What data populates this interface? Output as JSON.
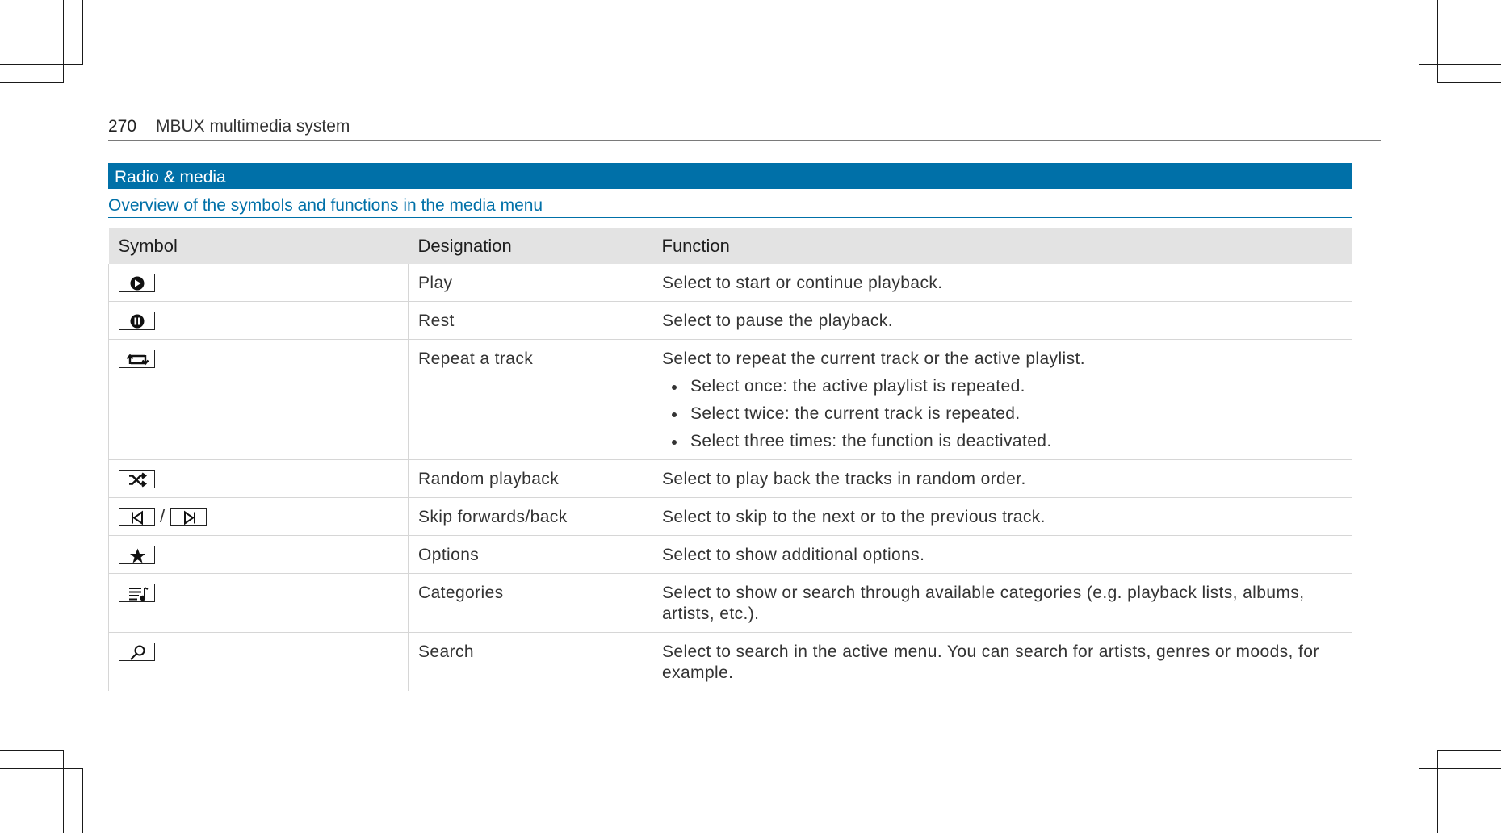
{
  "header": {
    "page_number": "270",
    "title": "MBUX multimedia system"
  },
  "section": {
    "title": "Radio & media"
  },
  "subsection": {
    "title": "Overview of the symbols and functions in the media menu"
  },
  "table": {
    "headers": {
      "symbol": "Symbol",
      "designation": "Designation",
      "function": "Function"
    },
    "rows": [
      {
        "icon": "play-icon",
        "designation": "Play",
        "function": "Select to start or continue playback."
      },
      {
        "icon": "pause-icon",
        "designation": "Rest",
        "function": "Select to pause the playback."
      },
      {
        "icon": "repeat-icon",
        "designation": "Repeat a track",
        "function": "Select to repeat the current track or the active playlist.",
        "bullets": [
          "Select once: the active playlist is repeated.",
          "Select twice: the current track is repeated.",
          "Select three times: the function is deactivated."
        ]
      },
      {
        "icon": "shuffle-icon",
        "designation": "Random playback",
        "function": "Select to play back the tracks in random order."
      },
      {
        "icon": "skip-back-icon / skip-forward-icon",
        "separator": "/",
        "designation": "Skip forwards/back",
        "function": "Select to skip to the next or to the previous track."
      },
      {
        "icon": "star-icon",
        "designation": "Options",
        "function": "Select to show additional options."
      },
      {
        "icon": "categories-icon",
        "designation": "Categories",
        "function": "Select to show or search through available categories (e.g. playback lists, albums, artists, etc.)."
      },
      {
        "icon": "search-icon",
        "designation": "Search",
        "function": "Select to search in the active menu. You can search for artists, genres or moods, for example."
      }
    ]
  }
}
